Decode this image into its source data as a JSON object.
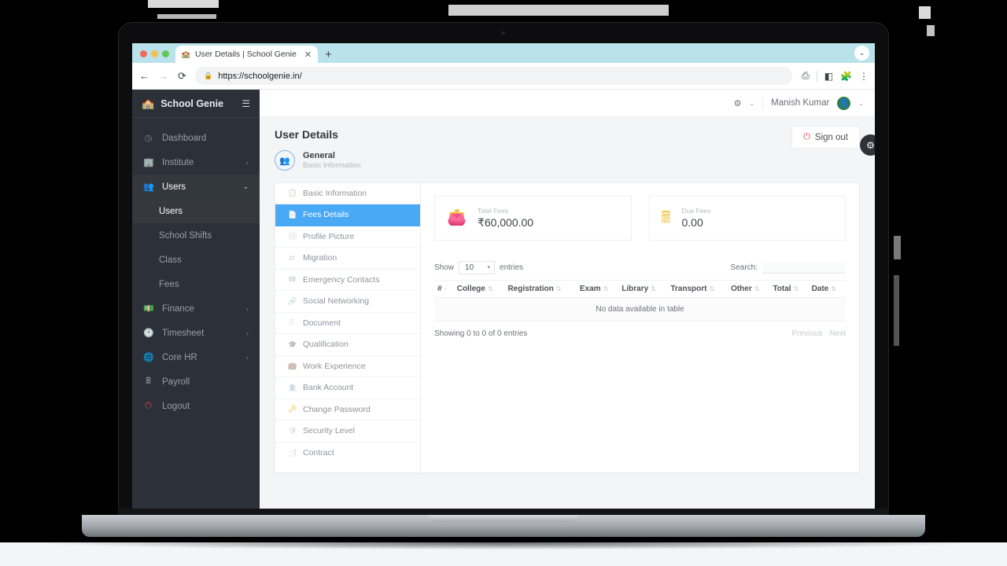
{
  "device": {
    "label": "MacBook Air"
  },
  "browser": {
    "tab": {
      "title": "User Details | School Genie",
      "favicon": "school-icon",
      "close_label": "✕"
    },
    "new_tab_label": "+",
    "tabbar_menu_icon": "chevron-down-icon",
    "nav": {
      "back": "←",
      "forward": "→",
      "reload": "⟳"
    },
    "url": "https://schoolgenie.in/",
    "lock_icon": "🔒",
    "toolbar_icons": [
      "install-app-icon",
      "split-view-icon",
      "extensions-icon",
      "browser-menu-icon"
    ]
  },
  "sidebar": {
    "brand": {
      "name": "School Genie",
      "logo_icon": "school-crest-icon",
      "menu_icon": "hamburger-icon"
    },
    "items": [
      {
        "label": "Dashboard",
        "icon": "gauge-icon",
        "caret": "",
        "state": "normal"
      },
      {
        "label": "Institute",
        "icon": "building-icon",
        "caret": "‹",
        "state": "normal"
      },
      {
        "label": "Users",
        "icon": "users-icon",
        "caret": "⌄",
        "state": "active"
      },
      {
        "label": "Finance",
        "icon": "money-icon",
        "caret": "‹",
        "state": "normal"
      },
      {
        "label": "Timesheet",
        "icon": "clock-icon",
        "caret": "‹",
        "state": "normal"
      },
      {
        "label": "Core HR",
        "icon": "globe-icon",
        "caret": "‹",
        "state": "normal"
      },
      {
        "label": "Payroll",
        "icon": "calculator-icon",
        "caret": "",
        "state": "normal"
      },
      {
        "label": "Logout",
        "icon": "power-icon",
        "caret": "",
        "state": "normal"
      }
    ],
    "subitems": [
      {
        "label": "Users",
        "selected": true
      },
      {
        "label": "School Shifts",
        "selected": false
      },
      {
        "label": "Class",
        "selected": false
      },
      {
        "label": "Fees",
        "selected": false
      }
    ]
  },
  "topbar": {
    "settings_icon": "gear-icon",
    "settings_caret": "⌄",
    "user_name": "Manish Kumar",
    "user_caret": "⌄",
    "avatar_icon": "user-avatar"
  },
  "page": {
    "title": "User Details",
    "signout_label": "Sign out",
    "signout_icon": "power-icon",
    "float_gear_icon": "gear-icon",
    "general": {
      "icon": "user-group-icon",
      "title": "General",
      "subtitle": "Basic Information"
    }
  },
  "tabs": [
    {
      "label": "Basic Information",
      "icon": "info-icon",
      "active": false
    },
    {
      "label": "Fees Details",
      "icon": "document-icon",
      "active": true
    },
    {
      "label": "Profile Picture",
      "icon": "image-icon",
      "active": false
    },
    {
      "label": "Migration",
      "icon": "transfer-icon",
      "active": false
    },
    {
      "label": "Emergency Contacts",
      "icon": "phone-icon",
      "active": false
    },
    {
      "label": "Social Networking",
      "icon": "share-icon",
      "active": false
    },
    {
      "label": "Document",
      "icon": "file-icon",
      "active": false
    },
    {
      "label": "Qualification",
      "icon": "certificate-icon",
      "active": false
    },
    {
      "label": "Work Experience",
      "icon": "briefcase-icon",
      "active": false
    },
    {
      "label": "Bank Account",
      "icon": "bank-icon",
      "active": false
    },
    {
      "label": "Change Password",
      "icon": "key-icon",
      "active": false
    },
    {
      "label": "Security Level",
      "icon": "shield-icon",
      "active": false
    },
    {
      "label": "Contract",
      "icon": "contract-icon",
      "active": false
    }
  ],
  "fee_cards": [
    {
      "label": "Total Fees",
      "value": "₹60,000.00",
      "icon": "wallet-icon",
      "color": "#4caf72"
    },
    {
      "label": "Due Fees",
      "value": "0.00",
      "icon": "calculator-icon",
      "color": "#f2c94c"
    }
  ],
  "datatable": {
    "show_label": "Show",
    "entries_label": "entries",
    "page_length": "10",
    "page_length_caret": "▾",
    "search_label": "Search:",
    "search_value": "",
    "columns": [
      {
        "label": "#",
        "sort": "↑"
      },
      {
        "label": "College",
        "sort": "⇅"
      },
      {
        "label": "Registration",
        "sort": "⇅"
      },
      {
        "label": "Exam",
        "sort": "⇅"
      },
      {
        "label": "Library",
        "sort": "⇅"
      },
      {
        "label": "Transport",
        "sort": "⇅"
      },
      {
        "label": "Other",
        "sort": "⇅"
      },
      {
        "label": "Total",
        "sort": "⇅"
      },
      {
        "label": "Date",
        "sort": "⇅"
      }
    ],
    "rows": [],
    "empty_message": "No data available in table",
    "info": "Showing 0 to 0 of 0 entries",
    "previous_label": "Previous",
    "next_label": "Next"
  }
}
